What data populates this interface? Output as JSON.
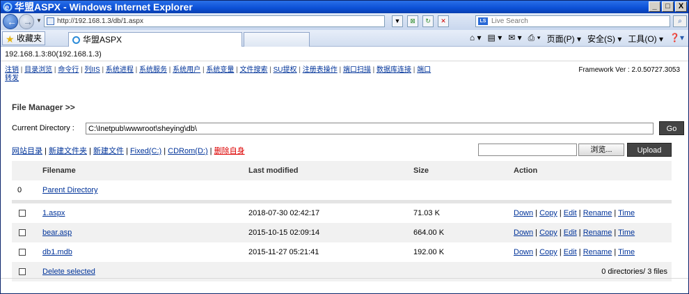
{
  "window": {
    "title": "华盟ASPX - Windows Internet Explorer",
    "minimize": "_",
    "maximize": "□",
    "close": "X"
  },
  "browser": {
    "url": "http://192.168.1.3/db/1.aspx",
    "search_placeholder": "Live Search",
    "favorites_label": "收藏夹",
    "tab_title": "华盟ASPX",
    "tools": [
      "页面(P)",
      "安全(S)",
      "工具(O)"
    ]
  },
  "page": {
    "host": "192.168.1.3:80(192.168.1.3)",
    "menu": [
      "注销",
      "目录浏览",
      "命令行",
      "列IIS",
      "系统进程",
      "系统服务",
      "系统用户",
      "系统变量",
      "文件搜索",
      "SU提权",
      "注册表操作",
      "端口扫描",
      "数据库连接",
      "端口"
    ],
    "menu_extra": "转发",
    "framework_version": "Framework Ver : 2.0.50727.3053",
    "fm_title": "File Manager >>",
    "current_dir_label": "Current Directory :",
    "current_dir_value": "C:\\Inetpub\\wwwroot\\sheying\\db\\",
    "go_label": "Go",
    "actions": [
      "网站目录",
      "新建文件夹",
      "新建文件",
      "Fixed(C:)",
      "CDRom(D:)"
    ],
    "delete_self": "删除自身",
    "browse_label": "浏览...",
    "upload_label": "Upload",
    "columns": [
      "Filename",
      "Last modified",
      "Size",
      "Action"
    ],
    "parent_index": "0",
    "parent_label": "Parent Directory",
    "files": [
      {
        "name": "1.aspx",
        "modified": "2018-07-30 02:42:17",
        "size": "71.03 K"
      },
      {
        "name": "bear.asp",
        "modified": "2015-10-15 02:09:14",
        "size": "664.00 K"
      },
      {
        "name": "db1.mdb",
        "modified": "2015-11-27 05:21:41",
        "size": "192.00 K"
      }
    ],
    "row_actions": [
      "Down",
      "Copy",
      "Edit",
      "Rename",
      "Time"
    ],
    "delete_selected": "Delete selected",
    "summary": "0 directories/ 3 files"
  }
}
